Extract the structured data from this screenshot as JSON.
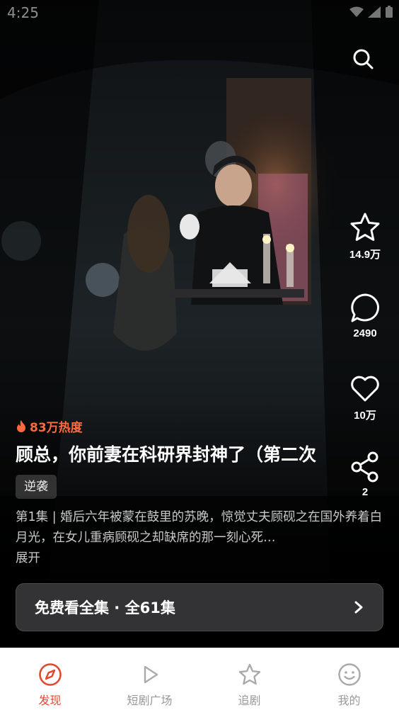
{
  "status_bar": {
    "time": "4:25"
  },
  "video": {
    "heat": "83万热度",
    "title": "顾总，你前妻在科研界封神了（第二次",
    "tag": "逆袭",
    "description": "第1集 | 婚后六年被蒙在鼓里的苏晚，惊觉丈夫顾砚之在国外养着白月光，在女儿重病顾砚之却缺席的那一刻心死…",
    "expand_label": "展开",
    "watch_all_label": "免费看全集 · 全61集"
  },
  "actions": {
    "favorite_count": "14.9万",
    "comment_count": "2490",
    "like_count": "10万",
    "share_count": "2"
  },
  "bottom_nav": [
    {
      "label": "发现",
      "icon": "compass-icon",
      "active": true
    },
    {
      "label": "短剧广场",
      "icon": "play-icon",
      "active": false
    },
    {
      "label": "追剧",
      "icon": "star-icon",
      "active": false
    },
    {
      "label": "我的",
      "icon": "smile-icon",
      "active": false
    }
  ],
  "colors": {
    "accent": "#e4472e",
    "heat": "#ff6a3d"
  }
}
